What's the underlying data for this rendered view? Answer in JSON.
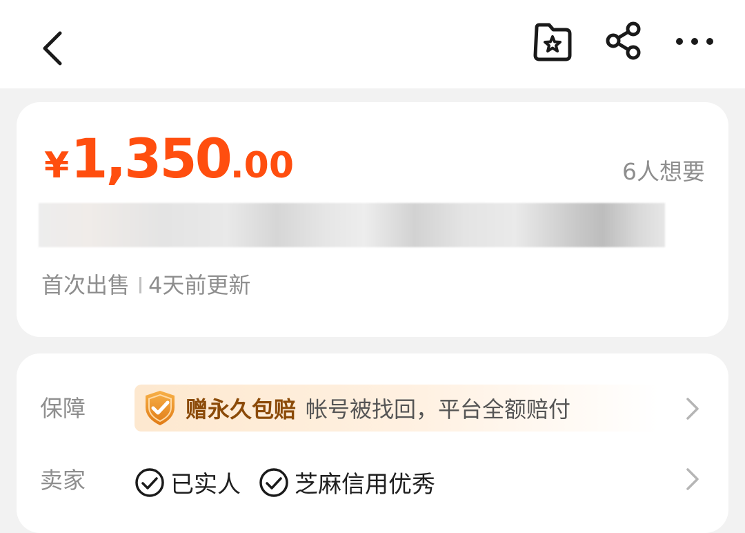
{
  "header": {
    "back_icon": "chevron-left-icon",
    "favorite_icon": "star-folder-icon",
    "share_icon": "share-icon",
    "more_icon": "more-dots-icon"
  },
  "price_card": {
    "currency": "¥",
    "price_integer": "1,350",
    "price_decimal": ".00",
    "want_count": "6人想要",
    "first_sale": "首次出售",
    "updated": "4天前更新"
  },
  "info_card": {
    "guarantee": {
      "label": "保障",
      "badge": "赠永久包赔",
      "description": "帐号被找回，平台全额赔付"
    },
    "seller": {
      "label": "卖家",
      "tags": [
        "已实人",
        "芝麻信用优秀"
      ]
    }
  },
  "colors": {
    "price": "#ff4e0f",
    "guarantee_text": "#8b4a08",
    "muted": "#8e8e8e"
  }
}
